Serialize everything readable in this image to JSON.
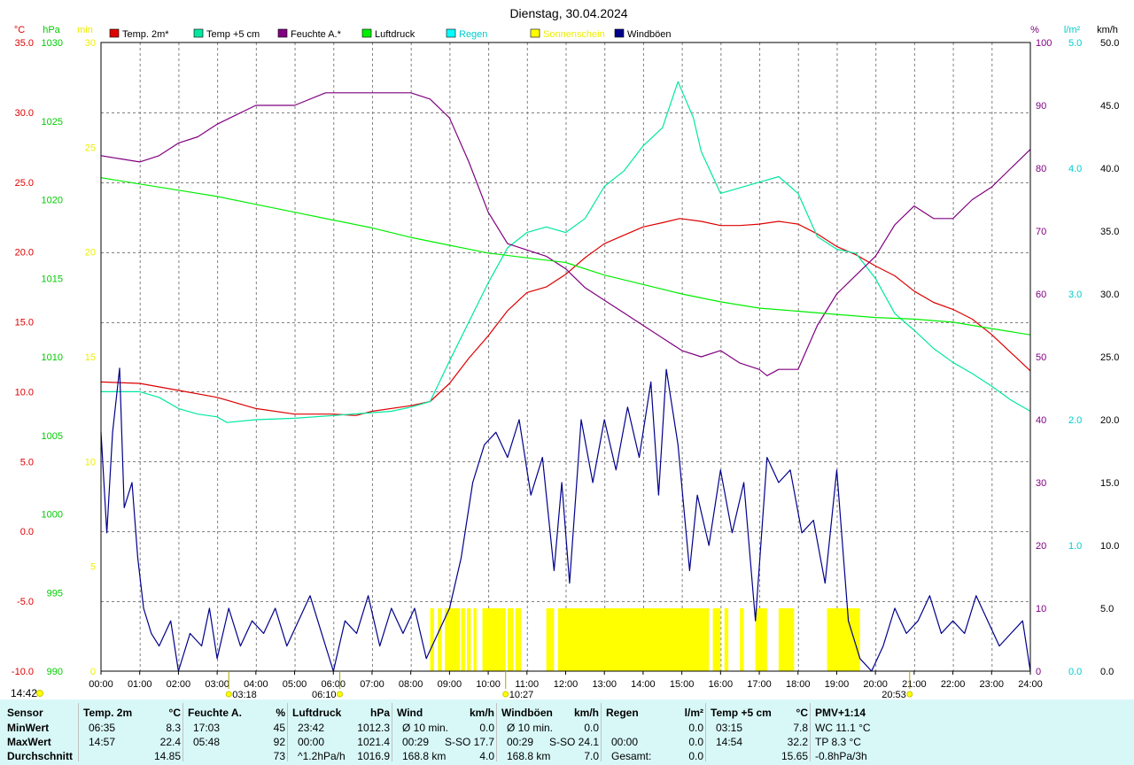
{
  "chart_data": {
    "type": "line",
    "title": "Dienstag, 30.04.2024",
    "x_ticks": [
      "00:00",
      "01:00",
      "02:00",
      "03:00",
      "04:00",
      "05:00",
      "06:00",
      "07:00",
      "08:00",
      "09:00",
      "10:00",
      "11:00",
      "12:00",
      "13:00",
      "14:00",
      "15:00",
      "16:00",
      "17:00",
      "18:00",
      "19:00",
      "20:00",
      "21:00",
      "22:00",
      "23:00",
      "24:00"
    ],
    "x_range_hours": [
      0,
      24
    ],
    "grid": true,
    "legend": [
      {
        "name": "Temp. 2m*",
        "color": "#dd0000",
        "text_color": "#000000"
      },
      {
        "name": "Temp +5 cm",
        "color": "#00e8a0",
        "text_color": "#000000"
      },
      {
        "name": "Feuchte A.*",
        "color": "#800080",
        "text_color": "#000000"
      },
      {
        "name": "Luftdruck",
        "color": "#00ee00",
        "text_color": "#000000"
      },
      {
        "name": "Regen",
        "color": "#00ffff",
        "text_color": "#00cccc"
      },
      {
        "name": "Sonnenschein",
        "color": "#ffff00",
        "text_color": "#eeee00"
      },
      {
        "name": "Windböen",
        "color": "#00008b",
        "text_color": "#000000"
      }
    ],
    "axes": {
      "temp": {
        "unit": "°C",
        "color": "#dd0000",
        "range": [
          -10,
          35
        ],
        "ticks": [
          "35.0",
          "30.0",
          "25.0",
          "20.0",
          "15.0",
          "10.0",
          "5.0",
          "0.0",
          "-5.0",
          "-10.0"
        ]
      },
      "pressure": {
        "unit": "hPa",
        "color": "#00cc00",
        "range": [
          990,
          1030
        ],
        "ticks": [
          "1030",
          "1025",
          "1020",
          "1015",
          "1010",
          "1005",
          "1000",
          "995",
          "990"
        ]
      },
      "sunshine": {
        "unit": "min",
        "color": "#eeee00",
        "range": [
          0,
          30
        ],
        "ticks": [
          "30",
          "25",
          "20",
          "15",
          "10",
          "5",
          "0"
        ]
      },
      "humidity": {
        "unit": "%",
        "color": "#800080",
        "range": [
          0,
          100
        ],
        "ticks": [
          "100",
          "90",
          "80",
          "70",
          "60",
          "50",
          "40",
          "30",
          "20",
          "10",
          "0"
        ]
      },
      "rain": {
        "unit": "l/m²",
        "color": "#00cccc",
        "range": [
          0,
          5
        ],
        "ticks": [
          "5.0",
          "4.0",
          "3.0",
          "2.0",
          "1.0",
          "0.0"
        ]
      },
      "wind": {
        "unit": "km/h",
        "color": "#000000",
        "range": [
          0,
          50
        ],
        "ticks": [
          "50.0",
          "45.0",
          "40.0",
          "35.0",
          "30.0",
          "25.0",
          "20.0",
          "15.0",
          "10.0",
          "5.0",
          "0.0"
        ]
      }
    },
    "series": [
      {
        "name": "Temp. 2m*",
        "axis": "temp",
        "color": "#dd0000",
        "x": [
          0,
          1,
          2,
          3,
          4,
          5,
          6,
          6.58,
          7,
          8,
          8.5,
          9,
          9.5,
          10,
          10.5,
          11,
          11.5,
          12,
          12.5,
          13,
          13.5,
          14,
          14.5,
          14.95,
          15.5,
          16,
          16.5,
          17,
          17.5,
          18,
          18.5,
          19,
          19.5,
          20,
          20.5,
          21,
          21.5,
          22,
          22.5,
          23,
          23.5,
          24
        ],
        "y": [
          10.7,
          10.6,
          10.1,
          9.6,
          8.8,
          8.4,
          8.4,
          8.3,
          8.6,
          9.0,
          9.3,
          10.6,
          12.4,
          14.0,
          15.8,
          17.1,
          17.5,
          18.4,
          19.6,
          20.6,
          21.2,
          21.8,
          22.1,
          22.4,
          22.2,
          21.9,
          21.9,
          22.0,
          22.2,
          22.0,
          21.3,
          20.4,
          19.8,
          19.0,
          18.3,
          17.2,
          16.4,
          15.9,
          15.2,
          14.1,
          12.8,
          11.5
        ]
      },
      {
        "name": "Temp +5 cm",
        "axis": "temp",
        "color": "#00e8a0",
        "x": [
          0,
          1,
          1.5,
          2,
          2.5,
          3,
          3.25,
          4,
          5,
          6,
          7,
          7.5,
          8,
          8.5,
          9,
          9.5,
          10,
          10.5,
          11,
          11.5,
          12,
          12.5,
          13,
          13.5,
          14,
          14.5,
          14.9,
          15.3,
          15.5,
          16,
          16.5,
          17,
          17.5,
          18,
          18.5,
          19,
          19.5,
          20,
          20.5,
          21,
          21.5,
          22,
          22.5,
          23,
          23.5,
          24
        ],
        "y": [
          10.0,
          10.0,
          9.6,
          8.8,
          8.4,
          8.2,
          7.8,
          8.0,
          8.1,
          8.3,
          8.5,
          8.6,
          8.9,
          9.3,
          12.2,
          15.0,
          17.8,
          20.3,
          21.4,
          21.8,
          21.4,
          22.4,
          24.7,
          25.8,
          27.6,
          28.9,
          32.2,
          29.6,
          27.2,
          24.2,
          24.6,
          25.0,
          25.4,
          24.2,
          21.1,
          20.2,
          19.9,
          18.1,
          15.6,
          14.4,
          13.1,
          12.1,
          11.3,
          10.4,
          9.4,
          8.6
        ]
      },
      {
        "name": "Feuchte A.*",
        "axis": "humidity",
        "color": "#800080",
        "x": [
          0,
          0.5,
          1,
          1.5,
          2,
          2.5,
          3,
          3.5,
          4,
          5,
          5.8,
          6,
          7,
          8,
          8.5,
          9,
          9.5,
          10,
          10.5,
          11,
          11.5,
          12,
          12.5,
          13,
          13.5,
          14,
          14.5,
          15,
          15.5,
          16,
          16.5,
          17,
          17.2,
          17.5,
          18,
          18.5,
          19,
          19.5,
          20,
          20.5,
          21,
          21.5,
          22,
          22.5,
          23,
          23.5,
          24
        ],
        "y": [
          82,
          81.5,
          81,
          82,
          84,
          85,
          87,
          88.5,
          90,
          90,
          92,
          92,
          92,
          92,
          91,
          88,
          81,
          73,
          68,
          67,
          66,
          64,
          61,
          59,
          57,
          55,
          53,
          51,
          50,
          51,
          49,
          48,
          47,
          48,
          48,
          55,
          60,
          63,
          66,
          71,
          74,
          72,
          72,
          75,
          77,
          80,
          83
        ]
      },
      {
        "name": "Luftdruck",
        "axis": "pressure",
        "color": "#00ee00",
        "x": [
          0,
          1,
          2,
          3,
          4,
          5,
          6,
          7,
          8,
          9,
          10,
          11,
          12,
          13,
          14,
          15,
          16,
          17,
          18,
          19,
          20,
          21,
          22,
          23,
          24
        ],
        "y": [
          1021.4,
          1021.0,
          1020.6,
          1020.2,
          1019.7,
          1019.2,
          1018.7,
          1018.2,
          1017.6,
          1017.1,
          1016.6,
          1016.3,
          1016.0,
          1015.2,
          1014.6,
          1014.0,
          1013.5,
          1013.1,
          1012.9,
          1012.7,
          1012.5,
          1012.4,
          1012.2,
          1011.8,
          1011.4
        ]
      },
      {
        "name": "Windböen",
        "axis": "wind",
        "color": "#00008b",
        "x": [
          0,
          0.15,
          0.3,
          0.48,
          0.6,
          0.8,
          0.95,
          1.1,
          1.3,
          1.5,
          1.8,
          2.0,
          2.3,
          2.6,
          2.8,
          3.0,
          3.3,
          3.6,
          3.9,
          4.2,
          4.5,
          4.8,
          5.1,
          5.4,
          5.7,
          6.0,
          6.3,
          6.6,
          6.9,
          7.2,
          7.5,
          7.8,
          8.1,
          8.4,
          8.7,
          9.0,
          9.3,
          9.6,
          9.9,
          10.2,
          10.5,
          10.8,
          11.1,
          11.4,
          11.7,
          11.9,
          12.1,
          12.4,
          12.7,
          13.0,
          13.3,
          13.6,
          13.9,
          14.2,
          14.4,
          14.6,
          14.9,
          15.2,
          15.4,
          15.7,
          16.0,
          16.3,
          16.6,
          16.9,
          17.2,
          17.5,
          17.8,
          18.1,
          18.4,
          18.7,
          19.0,
          19.3,
          19.6,
          19.9,
          20.2,
          20.5,
          20.8,
          21.1,
          21.4,
          21.7,
          22.0,
          22.3,
          22.6,
          22.9,
          23.2,
          23.5,
          23.8,
          24
        ],
        "y": [
          19,
          11,
          19,
          24.1,
          13,
          15,
          9,
          5,
          3,
          2,
          4,
          0,
          3,
          2,
          5,
          1,
          5,
          2,
          4,
          3,
          5,
          2,
          4,
          6,
          3,
          0,
          4,
          3,
          6,
          2,
          5,
          3,
          5,
          1,
          3,
          5,
          9,
          15,
          18,
          19,
          17,
          20,
          14,
          17,
          8,
          15,
          7,
          20,
          15,
          20,
          16,
          21,
          17,
          23,
          14,
          24,
          18,
          8,
          14,
          10,
          16,
          11,
          15,
          4,
          17,
          15,
          16,
          11,
          12,
          7,
          16,
          4,
          1,
          0,
          2,
          5,
          3,
          4,
          6,
          3,
          4,
          3,
          6,
          4,
          2,
          3,
          4,
          0
        ]
      }
    ],
    "sunshine_minutes": {
      "axis": "sunshine",
      "color": "#ffff00",
      "intervals": [
        [
          8.5,
          8.6
        ],
        [
          8.7,
          8.8
        ],
        [
          8.88,
          9.27
        ],
        [
          9.3,
          9.4
        ],
        [
          9.45,
          9.55
        ],
        [
          9.62,
          9.7
        ],
        [
          9.85,
          10.45
        ],
        [
          10.5,
          10.65
        ],
        [
          10.7,
          10.85
        ],
        [
          11.5,
          11.7
        ],
        [
          11.8,
          15.7
        ],
        [
          15.8,
          16.0
        ],
        [
          16.1,
          16.2
        ],
        [
          16.5,
          16.6
        ],
        [
          16.9,
          17.2
        ],
        [
          17.5,
          17.9
        ],
        [
          18.75,
          19.6
        ]
      ],
      "value": 3
    },
    "sun_markers": [
      {
        "time": "03:18",
        "label": "03:18"
      },
      {
        "time": "06:10",
        "label": "06:10"
      },
      {
        "time": "10:27",
        "label": "10:27"
      },
      {
        "time": "20:53",
        "label": "20:53"
      }
    ],
    "time_readout": "14:42"
  },
  "summary": {
    "sensor_col": {
      "header": "Sensor",
      "rows": [
        "MinWert",
        "MaxWert",
        "Durchschnitt"
      ]
    },
    "columns": [
      {
        "header": "Temp. 2m",
        "unit": "°C",
        "rows": [
          [
            "06:35",
            "8.3"
          ],
          [
            "14:57",
            "22.4"
          ],
          [
            "",
            "14.85"
          ]
        ]
      },
      {
        "header": "Feuchte A.",
        "unit": "%",
        "rows": [
          [
            "17:03",
            "45"
          ],
          [
            "05:48",
            "92"
          ],
          [
            "",
            "73"
          ]
        ]
      },
      {
        "header": "Luftdruck",
        "unit": "hPa",
        "rows": [
          [
            "23:42",
            "1012.3"
          ],
          [
            "00:00",
            "1021.4"
          ],
          [
            "^1.2hPa/h",
            "1016.9"
          ]
        ]
      },
      {
        "header": "Wind",
        "unit": "km/h",
        "rows": [
          [
            "Ø 10 min.",
            "0.0"
          ],
          [
            "00:29",
            "S-SO 17.7"
          ],
          [
            "168.8 km",
            "4.0"
          ]
        ]
      },
      {
        "header": "Windböen",
        "unit": "km/h",
        "rows": [
          [
            "Ø 10 min.",
            "0.0"
          ],
          [
            "00:29",
            "S-SO 24.1"
          ],
          [
            "168.8 km",
            "7.0"
          ]
        ]
      },
      {
        "header": "Regen",
        "unit": "l/m²",
        "rows": [
          [
            "",
            "0.0"
          ],
          [
            "00:00",
            "0.0"
          ],
          [
            "Gesamt:",
            "0.0"
          ]
        ]
      },
      {
        "header": "Temp +5 cm",
        "unit": "°C",
        "rows": [
          [
            "03:15",
            "7.8"
          ],
          [
            "14:54",
            "32.2"
          ],
          [
            "",
            "15.65"
          ]
        ]
      },
      {
        "header": "PMV+1:14",
        "unit": "",
        "rows": [
          [
            "WC 11.1 °C",
            ""
          ],
          [
            "TP 8.3 °C",
            ""
          ],
          [
            "-0.8hPa/3h",
            ""
          ]
        ]
      }
    ]
  }
}
